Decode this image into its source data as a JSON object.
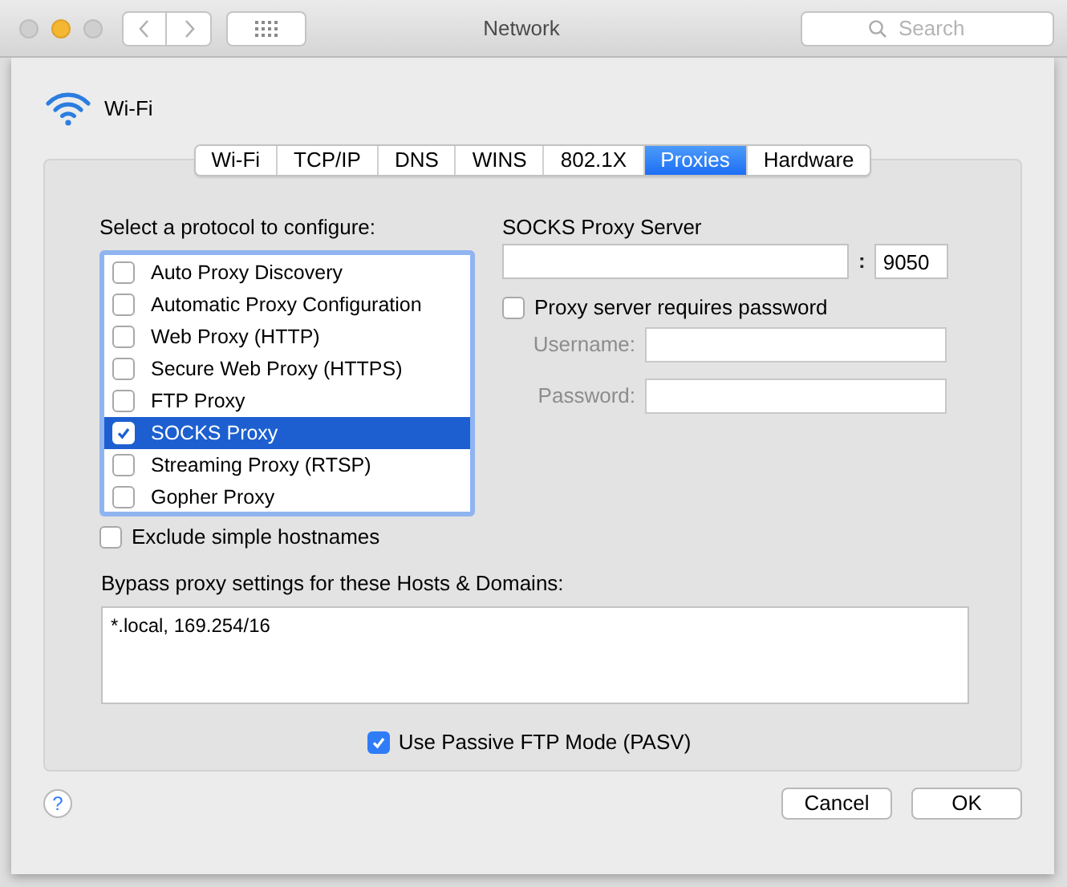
{
  "window": {
    "title": "Network",
    "search_placeholder": "Search"
  },
  "interface": {
    "name": "Wi-Fi"
  },
  "tabs": [
    {
      "label": "Wi-Fi",
      "selected": false
    },
    {
      "label": "TCP/IP",
      "selected": false
    },
    {
      "label": "DNS",
      "selected": false
    },
    {
      "label": "WINS",
      "selected": false
    },
    {
      "label": "802.1X",
      "selected": false
    },
    {
      "label": "Proxies",
      "selected": true
    },
    {
      "label": "Hardware",
      "selected": false
    }
  ],
  "protocols": {
    "label": "Select a protocol to configure:",
    "items": [
      {
        "label": "Auto Proxy Discovery",
        "checked": false,
        "selected": false
      },
      {
        "label": "Automatic Proxy Configuration",
        "checked": false,
        "selected": false
      },
      {
        "label": "Web Proxy (HTTP)",
        "checked": false,
        "selected": false
      },
      {
        "label": "Secure Web Proxy (HTTPS)",
        "checked": false,
        "selected": false
      },
      {
        "label": "FTP Proxy",
        "checked": false,
        "selected": false
      },
      {
        "label": "SOCKS Proxy",
        "checked": true,
        "selected": true
      },
      {
        "label": "Streaming Proxy (RTSP)",
        "checked": false,
        "selected": false
      },
      {
        "label": "Gopher Proxy",
        "checked": false,
        "selected": false
      }
    ]
  },
  "exclude_simple_hostnames": {
    "label": "Exclude simple hostnames",
    "checked": false
  },
  "server": {
    "title": "SOCKS Proxy Server",
    "separator": ":",
    "port": "9050"
  },
  "requires_password": {
    "label": "Proxy server requires password",
    "checked": false
  },
  "credentials": [
    {
      "label": "Username:",
      "disabled": true
    },
    {
      "label": "Password:",
      "disabled": true
    }
  ],
  "bypass": {
    "label": "Bypass proxy settings for these Hosts & Domains:",
    "value": "*.local, 169.254/16"
  },
  "passive_ftp": {
    "label": "Use Passive FTP Mode (PASV)",
    "checked": true
  },
  "help": "?",
  "buttons": [
    {
      "label": "Cancel"
    },
    {
      "label": "OK"
    }
  ]
}
